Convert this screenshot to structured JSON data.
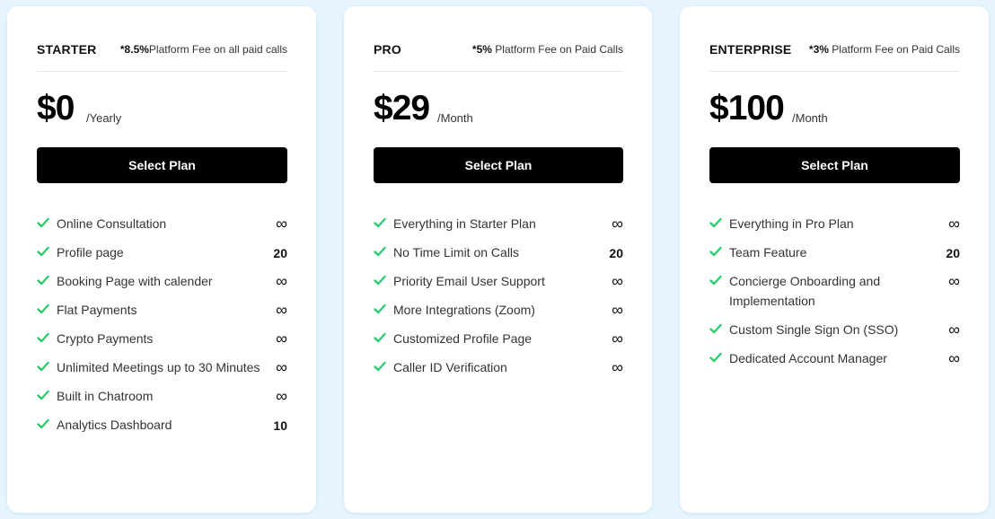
{
  "colors": {
    "background": "#e5f4fd",
    "check": "#2ecc71",
    "button": "#000000"
  },
  "plans": [
    {
      "name": "STARTER",
      "fee_bold": "*8.5%",
      "fee_text": "Platform Fee on all paid calls",
      "price": "$0",
      "period": "/Yearly",
      "button": "Select Plan",
      "features": [
        {
          "label": "Online Consultation",
          "value": "∞"
        },
        {
          "label": "Profile page",
          "value": "20"
        },
        {
          "label": "Booking Page with calender",
          "value": "∞"
        },
        {
          "label": "Flat Payments",
          "value": "∞"
        },
        {
          "label": "Crypto Payments",
          "value": "∞"
        },
        {
          "label": "Unlimited Meetings up to 30 Minutes",
          "value": "∞"
        },
        {
          "label": "Built in Chatroom",
          "value": "∞"
        },
        {
          "label": "Analytics Dashboard",
          "value": "10"
        }
      ]
    },
    {
      "name": "PRO",
      "fee_bold": "*5%",
      "fee_text": " Platform Fee on Paid Calls",
      "price": "$29",
      "period": "/Month",
      "button": "Select Plan",
      "features": [
        {
          "label": "Everything in Starter Plan",
          "value": "∞"
        },
        {
          "label": "No Time Limit on Calls",
          "value": "20"
        },
        {
          "label": "Priority Email User Support",
          "value": "∞"
        },
        {
          "label": "More Integrations (Zoom)",
          "value": "∞"
        },
        {
          "label": "Customized Profile Page",
          "value": "∞"
        },
        {
          "label": "Caller ID Verification",
          "value": "∞"
        }
      ]
    },
    {
      "name": "ENTERPRISE",
      "fee_bold": "*3%",
      "fee_text": " Platform Fee on Paid Calls",
      "price": "$100",
      "period": "/Month",
      "button": "Select Plan",
      "features": [
        {
          "label": "Everything in Pro Plan",
          "value": "∞"
        },
        {
          "label": "Team Feature",
          "value": "20"
        },
        {
          "label": "Concierge Onboarding and Implementation",
          "value": "∞"
        },
        {
          "label": "Custom Single Sign On (SSO)",
          "value": "∞"
        },
        {
          "label": "Dedicated Account Manager",
          "value": "∞"
        }
      ]
    }
  ]
}
